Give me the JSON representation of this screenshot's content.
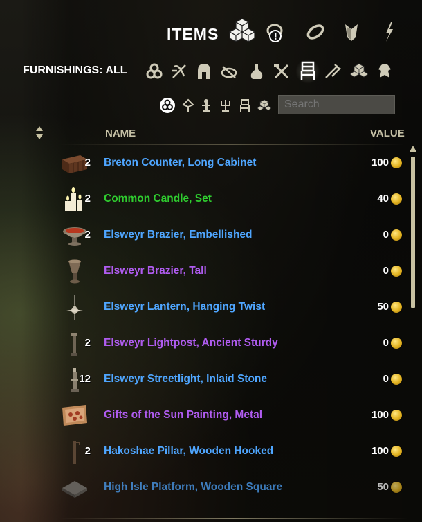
{
  "header": {
    "title": "ITEMS",
    "tabs": [
      {
        "icon": "cubes-icon",
        "active": true
      },
      {
        "icon": "stolen-items-icon",
        "active": false
      },
      {
        "icon": "jewelry-icon",
        "active": false
      },
      {
        "icon": "armor-icon",
        "active": false
      },
      {
        "icon": "weapons-icon",
        "active": false
      }
    ]
  },
  "filters": {
    "label": "FURNISHINGS: ALL",
    "categories": [
      {
        "icon": "all-categories-icon",
        "active": false
      },
      {
        "icon": "crafting-stations-icon",
        "active": false
      },
      {
        "icon": "helmet-icon",
        "active": false
      },
      {
        "icon": "tools-icon",
        "active": false
      },
      {
        "icon": "potion-icon",
        "active": false
      },
      {
        "icon": "weapons-cross-icon",
        "active": false
      },
      {
        "icon": "furniture-chair-icon",
        "active": true
      },
      {
        "icon": "mount-icon",
        "active": false
      },
      {
        "icon": "materials-icon",
        "active": false
      },
      {
        "icon": "trophy-icon",
        "active": false
      }
    ],
    "subcategories": [
      {
        "icon": "all-subcategories-icon",
        "active": true
      },
      {
        "icon": "lighting-icon",
        "active": false
      },
      {
        "icon": "statue-icon",
        "active": false
      },
      {
        "icon": "candelabra-icon",
        "active": false
      },
      {
        "icon": "chair-icon",
        "active": false
      },
      {
        "icon": "blocks-icon",
        "active": false
      }
    ],
    "search_placeholder": "Search"
  },
  "columns": {
    "name": "NAME",
    "value": "VALUE"
  },
  "colors": {
    "blue": "#4fa6ff",
    "green": "#2fcc2f",
    "purple": "#b05cf0"
  },
  "items": [
    {
      "qty": "2",
      "name": "Breton Counter, Long Cabinet",
      "value": "100",
      "quality": "blue",
      "icon": "cabinet-icon"
    },
    {
      "qty": "2",
      "name": "Common Candle, Set",
      "value": "40",
      "quality": "green",
      "icon": "candle-icon"
    },
    {
      "qty": "2",
      "name": "Elsweyr Brazier, Embellished",
      "value": "0",
      "quality": "blue",
      "icon": "brazier-icon"
    },
    {
      "qty": "",
      "name": "Elsweyr Brazier, Tall",
      "value": "0",
      "quality": "purple",
      "icon": "tall-brazier-icon"
    },
    {
      "qty": "",
      "name": "Elsweyr Lantern, Hanging Twist",
      "value": "50",
      "quality": "blue",
      "icon": "lantern-icon"
    },
    {
      "qty": "2",
      "name": "Elsweyr Lightpost, Ancient Sturdy",
      "value": "0",
      "quality": "purple",
      "icon": "lightpost-icon"
    },
    {
      "qty": "12",
      "name": "Elsweyr Streetlight, Inlaid Stone",
      "value": "0",
      "quality": "blue",
      "icon": "streetlight-icon"
    },
    {
      "qty": "",
      "name": "Gifts of the Sun Painting, Metal",
      "value": "100",
      "quality": "purple",
      "icon": "painting-icon"
    },
    {
      "qty": "2",
      "name": "Hakoshae Pillar, Wooden Hooked",
      "value": "100",
      "quality": "blue",
      "icon": "pillar-icon"
    },
    {
      "qty": "",
      "name": "High Isle Platform, Wooden Square",
      "value": "50",
      "quality": "blue",
      "icon": "platform-icon"
    }
  ]
}
